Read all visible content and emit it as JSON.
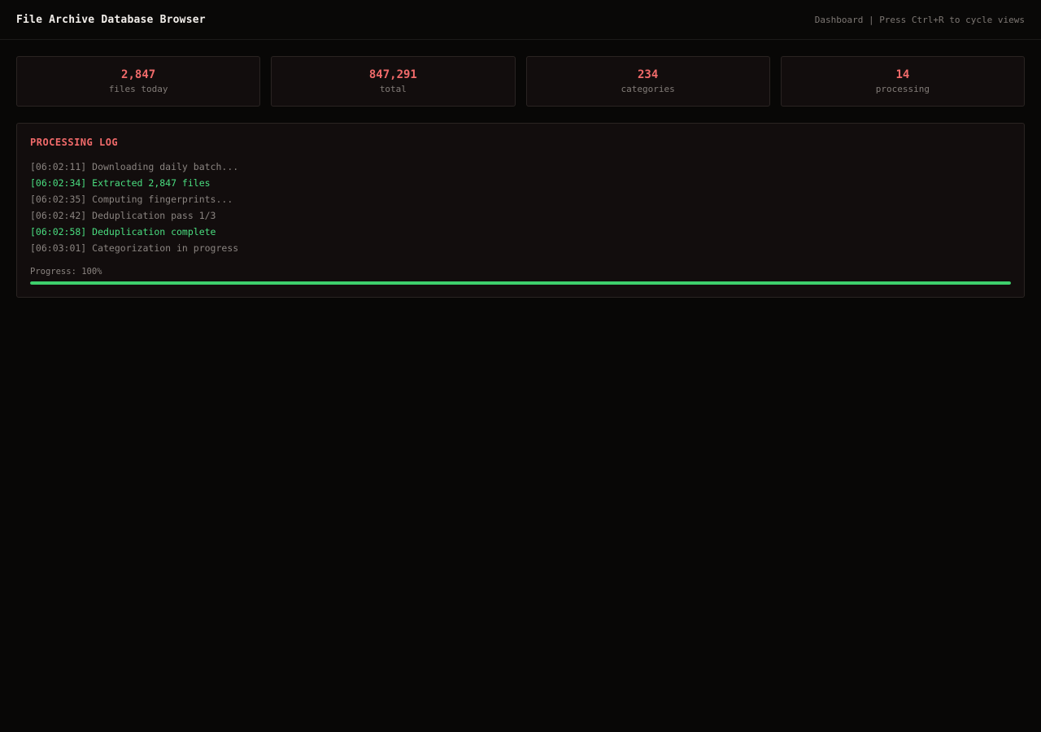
{
  "header": {
    "title": "File Archive Database Browser",
    "hint": "Dashboard | Press Ctrl+R to cycle views"
  },
  "stats": [
    {
      "value": "2,847",
      "label": "files today"
    },
    {
      "value": "847,291",
      "label": "total"
    },
    {
      "value": "234",
      "label": "categories"
    },
    {
      "value": "14",
      "label": "processing"
    }
  ],
  "log": {
    "title": "PROCESSING LOG",
    "lines": [
      {
        "text": "[06:02:11] Downloading daily batch...",
        "status": "info"
      },
      {
        "text": "[06:02:34] Extracted 2,847 files",
        "status": "success"
      },
      {
        "text": "[06:02:35] Computing fingerprints...",
        "status": "info"
      },
      {
        "text": "[06:02:42] Deduplication pass 1/3",
        "status": "info"
      },
      {
        "text": "[06:02:58] Deduplication complete",
        "status": "success"
      },
      {
        "text": "[06:03:01] Categorization in progress",
        "status": "info"
      }
    ],
    "progress_label": "Progress: 100%",
    "progress_percent": 100
  },
  "colors": {
    "accent": "#f06a6a",
    "success": "#4ade80",
    "progress": "#3ecf6c",
    "background": "#080706",
    "panel": "#120d0d"
  }
}
